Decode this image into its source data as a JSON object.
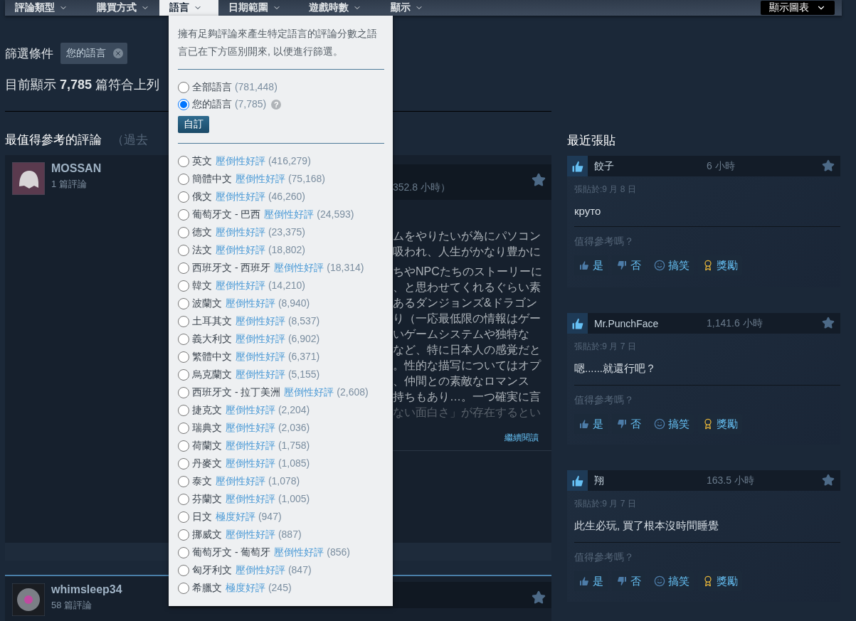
{
  "filter_tabs": [
    {
      "label": "評論類型",
      "selected": false
    },
    {
      "label": "購買方式",
      "selected": false
    },
    {
      "label": "語言",
      "selected": true
    },
    {
      "label": "日期範圍",
      "selected": false
    },
    {
      "label": "遊戲時數",
      "selected": false
    },
    {
      "label": "顯示",
      "selected": false
    }
  ],
  "chart_button": {
    "label": "顯示圖表"
  },
  "filters": {
    "label": "篩選條件",
    "tags": [
      {
        "label": "您的語言"
      }
    ]
  },
  "summary": "目前顯示 **7,785** 篇符合上列",
  "reviews_section": {
    "title": "最值得參考的評論",
    "subtitle": "（過去"
  },
  "reviews": [
    {
      "author": "MOSSAN",
      "review_count": "1 篇評論",
      "kind": "ghost",
      "playtime": "352.8 小時）",
      "text_paragraphs": [
        [
          "ムをやりたいが為にパソコン",
          "吸われ、人生がかなり豊かに"
        ],
        [
          "ちやNPCたちのストーリーに",
          "、と思わせてくれるぐらい素",
          "あるダンジョンズ&ドラゴン",
          "り（一応最低限の情報はゲー",
          "いゲームシステムや独特な",
          "など、特に日本人の感覚だと",
          "。性的な描写についてはオプ",
          "、仲間との素敵なロマンス",
          "持ちもあり…。一つ確実に言",
          "ない面白さ」が存在するとい"
        ]
      ],
      "read_more": "繼續閱讀"
    },
    {
      "author": "whimsleep34",
      "review_count": "58 篇評論",
      "kind": "orb"
    }
  ],
  "language_dropdown": {
    "description": "擁有足夠評論來產生特定語言的評論分數之語言已在下方區別開來, 以便進行篩選。",
    "scopes": [
      {
        "label": "全部語言",
        "count": "(781,448)",
        "selected": false
      },
      {
        "label": "您的語言",
        "count": "(7,785)",
        "selected": true,
        "help": "?"
      }
    ],
    "customize_button": "自訂",
    "languages": [
      {
        "name": "英文",
        "rating": "壓倒性好評",
        "count": "(416,279)",
        "selected": false
      },
      {
        "name": "簡體中文",
        "rating": "壓倒性好評",
        "count": "(75,168)",
        "selected": false
      },
      {
        "name": "俄文",
        "rating": "壓倒性好評",
        "count": "(46,260)",
        "selected": false
      },
      {
        "name": "葡萄牙文 - 巴西",
        "rating": "壓倒性好評",
        "count": "(24,593)",
        "selected": false
      },
      {
        "name": "德文",
        "rating": "壓倒性好評",
        "count": "(23,375)",
        "selected": false
      },
      {
        "name": "法文",
        "rating": "壓倒性好評",
        "count": "(18,802)",
        "selected": false
      },
      {
        "name": "西班牙文 - 西班牙",
        "rating": "壓倒性好評",
        "count": "(18,314)",
        "selected": false
      },
      {
        "name": "韓文",
        "rating": "壓倒性好評",
        "count": "(14,210)",
        "selected": false
      },
      {
        "name": "波蘭文",
        "rating": "壓倒性好評",
        "count": "(8,940)",
        "selected": false
      },
      {
        "name": "土耳其文",
        "rating": "壓倒性好評",
        "count": "(8,537)",
        "selected": false
      },
      {
        "name": "義大利文",
        "rating": "壓倒性好評",
        "count": "(6,902)",
        "selected": false
      },
      {
        "name": "繁體中文",
        "rating": "壓倒性好評",
        "count": "(6,371)",
        "selected": false
      },
      {
        "name": "烏克蘭文",
        "rating": "壓倒性好評",
        "count": "(5,155)",
        "selected": false
      },
      {
        "name": "西班牙文 - 拉丁美洲",
        "rating": "壓倒性好評",
        "count": "(2,608)",
        "selected": false
      },
      {
        "name": "捷克文",
        "rating": "壓倒性好評",
        "count": "(2,204)",
        "selected": false
      },
      {
        "name": "瑞典文",
        "rating": "壓倒性好評",
        "count": "(2,036)",
        "selected": false
      },
      {
        "name": "荷蘭文",
        "rating": "壓倒性好評",
        "count": "(1,758)",
        "selected": false
      },
      {
        "name": "丹麥文",
        "rating": "壓倒性好評",
        "count": "(1,085)",
        "selected": false
      },
      {
        "name": "泰文",
        "rating": "壓倒性好評",
        "count": "(1,078)",
        "selected": false
      },
      {
        "name": "芬蘭文",
        "rating": "壓倒性好評",
        "count": "(1,005)",
        "selected": false
      },
      {
        "name": "日文",
        "rating": "極度好評",
        "count": "(947)",
        "selected": false
      },
      {
        "name": "挪威文",
        "rating": "壓倒性好評",
        "count": "(887)",
        "selected": false
      },
      {
        "name": "葡萄牙文 - 葡萄牙",
        "rating": "壓倒性好評",
        "count": "(856)",
        "selected": false
      },
      {
        "name": "匈牙利文",
        "rating": "壓倒性好評",
        "count": "(847)",
        "selected": false
      },
      {
        "name": "希臘文",
        "rating": "極度好評",
        "count": "(245)",
        "selected": false
      }
    ]
  },
  "recent_posts": {
    "title": "最近張貼",
    "posts": [
      {
        "author": "餃子",
        "playtime": "6 小時",
        "posted": "張貼於:9 月 8 日",
        "text": "круто",
        "helpful_prompt": "值得參考嗎？",
        "actions": [
          {
            "kind": "yes",
            "label": "是"
          },
          {
            "kind": "no",
            "label": "否"
          },
          {
            "kind": "funny",
            "label": "搞笑"
          },
          {
            "kind": "award",
            "label": "獎勵"
          }
        ]
      },
      {
        "author": "Mr.PunchFace",
        "playtime": "1,141.6 小時",
        "posted": "張貼於:9 月 7 日",
        "text": "嗯......就還行吧？",
        "helpful_prompt": "值得參考嗎？",
        "actions": [
          {
            "kind": "yes",
            "label": "是"
          },
          {
            "kind": "no",
            "label": "否"
          },
          {
            "kind": "funny",
            "label": "搞笑"
          },
          {
            "kind": "award",
            "label": "獎勵"
          }
        ]
      },
      {
        "author": "翔",
        "playtime": "163.5 小時",
        "posted": "張貼於:9 月 7 日",
        "text": "此生必玩, 買了根本沒時間睡覺",
        "helpful_prompt": "值得參考嗎？",
        "actions": [
          {
            "kind": "yes",
            "label": "是"
          },
          {
            "kind": "no",
            "label": "否"
          },
          {
            "kind": "funny",
            "label": "搞笑"
          },
          {
            "kind": "award",
            "label": "獎勵"
          }
        ]
      }
    ]
  }
}
